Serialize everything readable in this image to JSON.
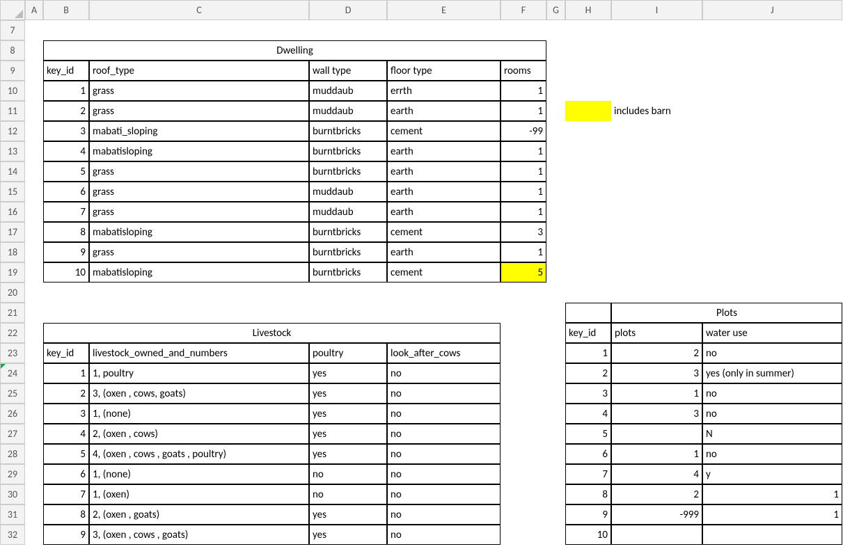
{
  "columns": [
    "A",
    "B",
    "C",
    "D",
    "E",
    "F",
    "G",
    "H",
    "I",
    "J"
  ],
  "rows": [
    "7",
    "8",
    "9",
    "10",
    "11",
    "12",
    "13",
    "14",
    "15",
    "16",
    "17",
    "18",
    "19",
    "20",
    "21",
    "22",
    "23",
    "24",
    "25",
    "26",
    "27",
    "28",
    "29",
    "30",
    "31",
    "32"
  ],
  "dwelling": {
    "title": "Dwelling",
    "headers": {
      "key_id": "key_id",
      "roof_type": "roof_type",
      "wall_type": "wall type",
      "floor_type": "floor type",
      "rooms": "rooms"
    },
    "rows": [
      {
        "key_id": "1",
        "roof_type": "grass",
        "wall_type": "muddaub",
        "floor_type": "errth",
        "rooms": "1"
      },
      {
        "key_id": "2",
        "roof_type": "grass",
        "wall_type": "muddaub",
        "floor_type": "earth",
        "rooms": "1"
      },
      {
        "key_id": "3",
        "roof_type": "mabati_sloping",
        "wall_type": "burntbricks",
        "floor_type": "cement",
        "rooms": "-99"
      },
      {
        "key_id": "4",
        "roof_type": "mabatisloping",
        "wall_type": "burntbricks",
        "floor_type": "earth",
        "rooms": "1"
      },
      {
        "key_id": "5",
        "roof_type": "grass",
        "wall_type": "burntbricks",
        "floor_type": "earth",
        "rooms": "1"
      },
      {
        "key_id": "6",
        "roof_type": "grass",
        "wall_type": "muddaub",
        "floor_type": "earth",
        "rooms": "1"
      },
      {
        "key_id": "7",
        "roof_type": "grass",
        "wall_type": "muddaub",
        "floor_type": "earth",
        "rooms": "1"
      },
      {
        "key_id": "8",
        "roof_type": "mabatisloping",
        "wall_type": "burntbricks",
        "floor_type": "cement",
        "rooms": "3"
      },
      {
        "key_id": "9",
        "roof_type": "grass",
        "wall_type": "burntbricks",
        "floor_type": "earth",
        "rooms": "1"
      },
      {
        "key_id": "10",
        "roof_type": "mabatisloping",
        "wall_type": "burntbricks",
        "floor_type": "cement",
        "rooms": "5"
      }
    ]
  },
  "note": {
    "label": "includes barn"
  },
  "livestock": {
    "title": "Livestock",
    "headers": {
      "key_id": "key_id",
      "owned": "livestock_owned_and_numbers",
      "poultry": "poultry",
      "cows": "look_after_cows"
    },
    "rows": [
      {
        "key_id": "1",
        "owned": "1, poultry",
        "poultry": "yes",
        "cows": "no"
      },
      {
        "key_id": "2",
        "owned": "3, (oxen ,  cows,  goats)",
        "poultry": "yes",
        "cows": "no"
      },
      {
        "key_id": "3",
        "owned": "1, (none)",
        "poultry": "yes",
        "cows": "no"
      },
      {
        "key_id": "4",
        "owned": "2, (oxen ,  cows)",
        "poultry": "yes",
        "cows": "no"
      },
      {
        "key_id": "5",
        "owned": "4, (oxen ,  cows ,  goats ,  poultry)",
        "poultry": "yes",
        "cows": "no"
      },
      {
        "key_id": "6",
        "owned": "1, (none)",
        "poultry": "no",
        "cows": "no"
      },
      {
        "key_id": "7",
        "owned": "1, (oxen)",
        "poultry": "no",
        "cows": "no"
      },
      {
        "key_id": "8",
        "owned": "2, (oxen ,  goats)",
        "poultry": "yes",
        "cows": "no"
      },
      {
        "key_id": "9",
        "owned": "3, (oxen ,  cows ,  goats)",
        "poultry": "yes",
        "cows": "no"
      }
    ]
  },
  "plots": {
    "title": "Plots",
    "headers": {
      "key_id": "key_id",
      "plots": "plots",
      "water": "water use"
    },
    "rows": [
      {
        "key_id": "1",
        "plots": "2",
        "water": "no"
      },
      {
        "key_id": "2",
        "plots": "3",
        "water": "yes (only in summer)"
      },
      {
        "key_id": "3",
        "plots": "1",
        "water": "no"
      },
      {
        "key_id": "4",
        "plots": "3",
        "water": "no"
      },
      {
        "key_id": "5",
        "plots": "",
        "water": "N"
      },
      {
        "key_id": "6",
        "plots": "1",
        "water": "no"
      },
      {
        "key_id": "7",
        "plots": "4",
        "water": "y"
      },
      {
        "key_id": "8",
        "plots": "2",
        "water": "1"
      },
      {
        "key_id": "9",
        "plots": "-999",
        "water": "1"
      },
      {
        "key_id": "10",
        "plots": "",
        "water": ""
      }
    ]
  }
}
